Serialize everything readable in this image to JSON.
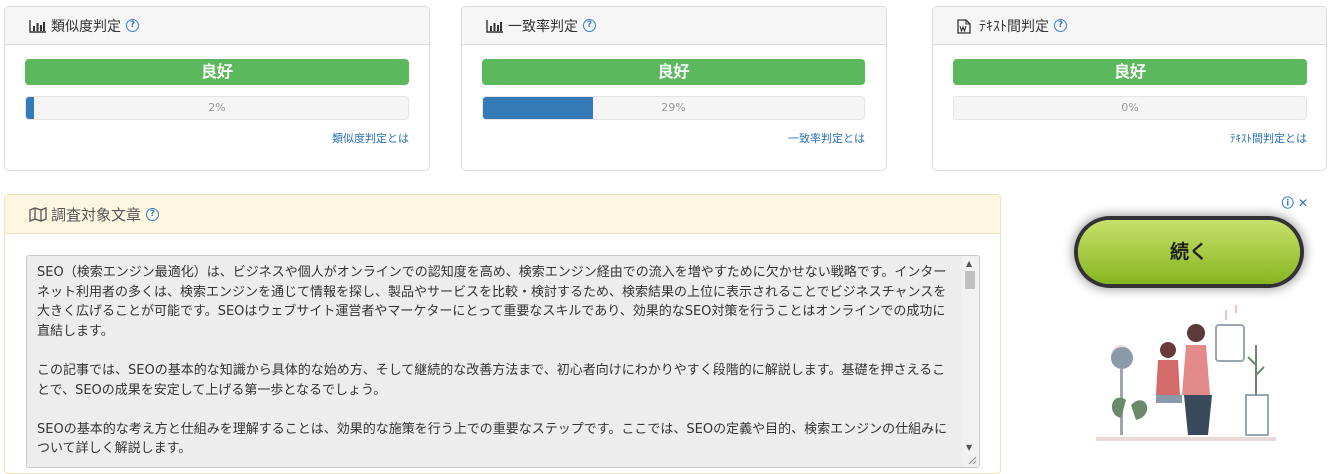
{
  "cards": [
    {
      "title": "類似度判定",
      "result": "良好",
      "percent_label": "2%",
      "percent": 2,
      "link": "類似度判定とは"
    },
    {
      "title": "一致率判定",
      "result": "良好",
      "percent_label": "29%",
      "percent": 29,
      "link": "一致率判定とは"
    },
    {
      "title": "ﾃｷｽﾄ間判定",
      "result": "良好",
      "percent_label": "0%",
      "percent": 0,
      "link": "ﾃｷｽﾄ間判定とは"
    }
  ],
  "help_glyph": "?",
  "target": {
    "title": "調査対象文章",
    "paragraphs": [
      "SEO（検索エンジン最適化）は、ビジネスや個人がオンラインでの認知度を高め、検索エンジン経由での流入を増やすために欠かせない戦略です。インターネット利用者の多くは、検索エンジンを通じて情報を探し、製品やサービスを比較・検討するため、検索結果の上位に表示されることでビジネスチャンスを大きく広げることが可能です。SEOはウェブサイト運営者やマーケターにとって重要なスキルであり、効果的なSEO対策を行うことはオンラインでの成功に直結します。",
      "この記事では、SEOの基本的な知識から具体的な始め方、そして継続的な改善方法まで、初心者向けにわかりやすく段階的に解説します。基礎を押さえることで、SEOの成果を安定して上げる第一歩となるでしょう。",
      "SEOの基本的な考え方と仕組みを理解することは、効果的な施策を行う上での重要なステップです。ここでは、SEOの定義や目的、検索エンジンの仕組みについて詳しく解説します。"
    ]
  },
  "ad": {
    "button": "続く",
    "close": "ⓘ ✕"
  },
  "colors": {
    "good": "#5cb85c",
    "bar": "#337ab7",
    "link": "#2a6fb6"
  }
}
